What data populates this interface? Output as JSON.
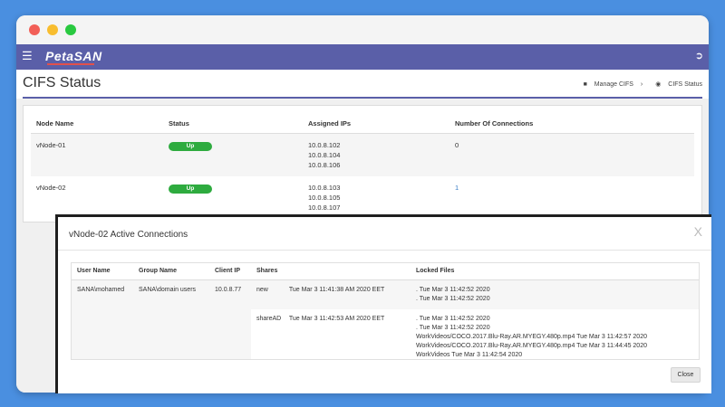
{
  "app": {
    "logo": "PetaSAN"
  },
  "header": {
    "title": "CIFS Status"
  },
  "breadcrumb": [
    {
      "icon": "folder-icon",
      "label": "Manage CIFS"
    },
    {
      "icon": "eye-icon",
      "label": "CIFS Status"
    }
  ],
  "status_table": {
    "columns": [
      "Node Name",
      "Status",
      "Assigned IPs",
      "Number Of Connections"
    ],
    "rows": [
      {
        "node": "vNode-01",
        "status": "Up",
        "ips": [
          "10.0.8.102",
          "10.0.8.104",
          "10.0.8.106"
        ],
        "connections": "0"
      },
      {
        "node": "vNode-02",
        "status": "Up",
        "ips": [
          "10.0.8.103",
          "10.0.8.105",
          "10.0.8.107"
        ],
        "connections": "1"
      }
    ]
  },
  "modal": {
    "title": "vNode-02 Active Connections",
    "close_x": "X",
    "close_button": "Close",
    "columns": [
      "User Name",
      "Group Name",
      "Client IP",
      "Shares",
      "Locked Files"
    ],
    "row": {
      "user": "SANA\\mohamed",
      "group": "SANA\\domain users",
      "ip": "10.0.8.77",
      "shares": [
        {
          "name": "new",
          "time": "Tue Mar 3 11:41:38 AM 2020 EET",
          "locked": [
            ". Tue Mar 3 11:42:52 2020",
            ". Tue Mar 3 11:42:52 2020"
          ]
        },
        {
          "name": "shareAD",
          "time": "Tue Mar 3 11:42:53 AM 2020 EET",
          "locked": [
            ". Tue Mar 3 11:42:52 2020",
            ". Tue Mar 3 11:42:52 2020",
            "WorkVideos/COCO.2017.Blu-Ray.AR.MYEGY.480p.mp4   Tue Mar 3 11:42:57 2020",
            "WorkVideos/COCO.2017.Blu-Ray.AR.MYEGY.480p.mp4   Tue Mar 3 11:44:45 2020",
            "WorkVideos   Tue Mar 3 11:42:54 2020"
          ]
        }
      ]
    }
  },
  "colors": {
    "navbar": "#5a5fa8",
    "badge": "#2eab3f",
    "link": "#3a7ec6",
    "background": "#4a8fe0"
  }
}
